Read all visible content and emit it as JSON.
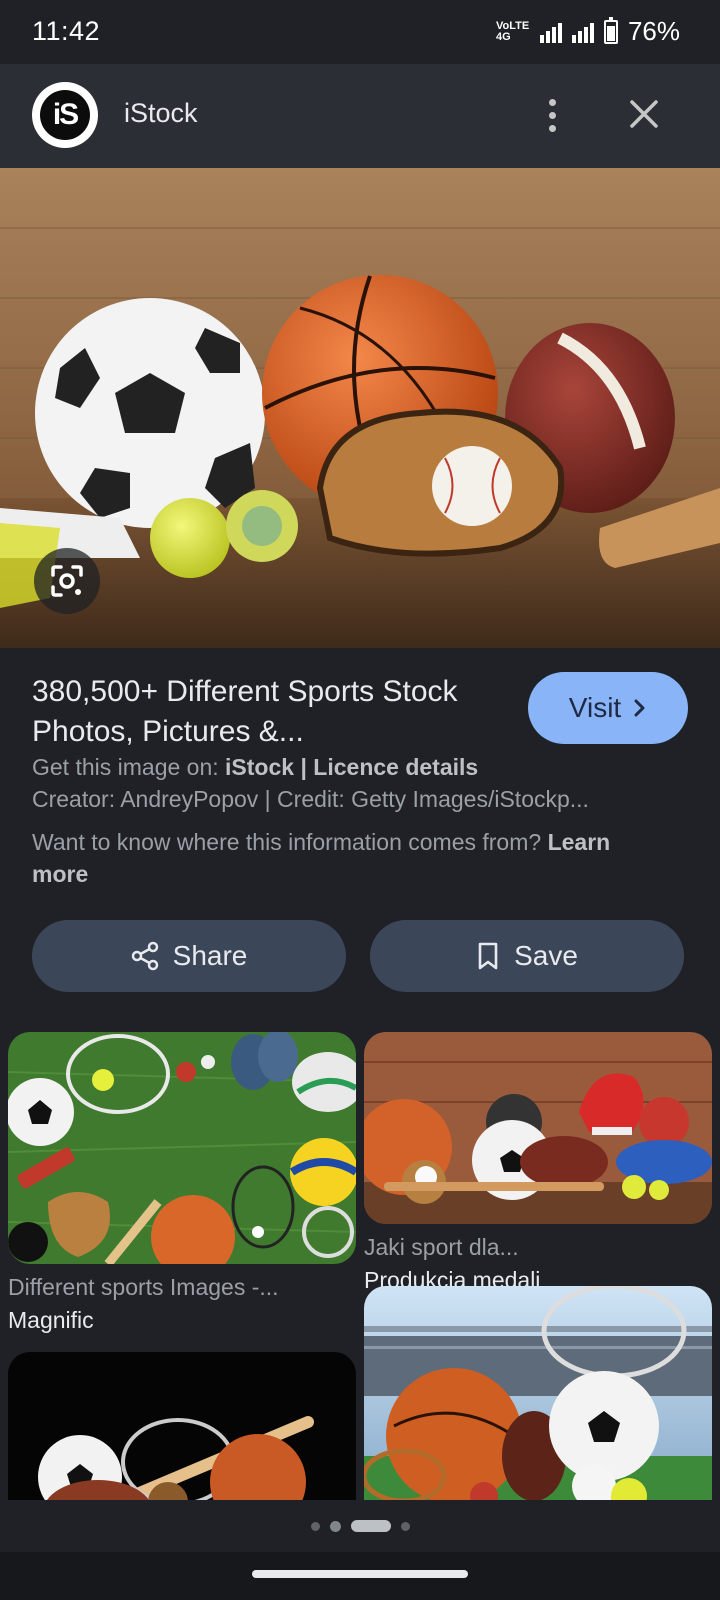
{
  "status_bar": {
    "time": "11:42",
    "network": "VoLTE 4G",
    "battery": "76%"
  },
  "header": {
    "logo_text": "iS",
    "site_name": "iStock"
  },
  "result": {
    "title": "380,500+ Different Sports Stock Photos, Pictures &...",
    "visit_label": "Visit",
    "source_prefix": "Get this image on: ",
    "source_name": "iStock",
    "source_separator": " | ",
    "licence_label": "Licence details",
    "creator_credit": "Creator: AndreyPopov | Credit: Getty Images/iStockp...",
    "info_question": "Want to know where this information comes from? ",
    "learn_more": "Learn more"
  },
  "actions": {
    "share_label": "Share",
    "save_label": "Save"
  },
  "related": [
    {
      "title": "Different sports Images -...",
      "source": "Magnific"
    },
    {
      "title": "Jaki sport dla...",
      "source": "Produkcja medali"
    }
  ],
  "colors": {
    "background": "#1f2126",
    "header": "#2b2e34",
    "visit_button": "#8ab4f8",
    "action_button": "#3c4659"
  },
  "icons": [
    "back-chevron",
    "share-icon",
    "bookmark-icon",
    "more-vert-icon",
    "close-icon",
    "google-lens-icon"
  ]
}
